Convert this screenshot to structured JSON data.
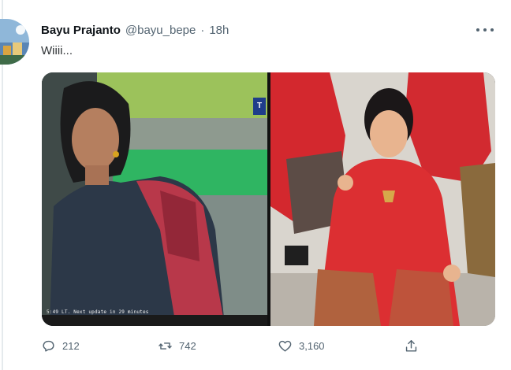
{
  "tweet": {
    "author_name": "Bayu Prajanto",
    "author_handle": "@bayu_bepe",
    "separator": "·",
    "timestamp": "18h",
    "text": "Wiiii..."
  },
  "media": {
    "left_caption": "5:49 LT. Next update in 29 minutes"
  },
  "actions": {
    "reply_count": "212",
    "retweet_count": "742",
    "like_count": "3,160"
  },
  "icons": {
    "more": "more-horizontal-icon",
    "reply": "reply-icon",
    "retweet": "retweet-icon",
    "like": "heart-icon",
    "share": "share-icon"
  },
  "colors": {
    "text_primary": "#0f1419",
    "text_secondary": "#536471",
    "kebaya_red": "#d8262b"
  }
}
